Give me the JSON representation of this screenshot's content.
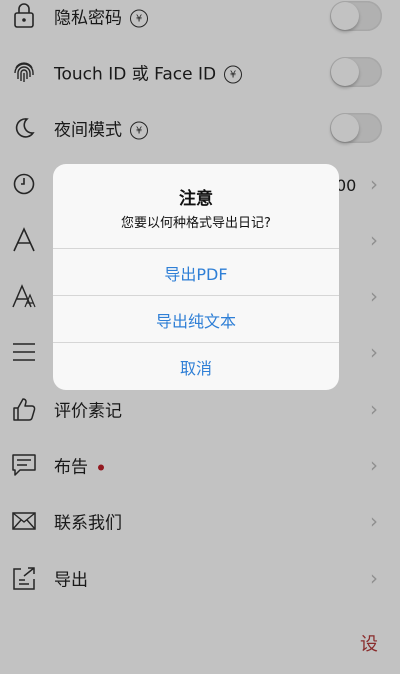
{
  "settings": {
    "items": [
      {
        "label": "隐私密码",
        "icon": "lock-icon",
        "premium": "¥",
        "control": "toggle"
      },
      {
        "label": "Touch ID 或 Face ID",
        "icon": "fingerprint-icon",
        "premium": "¥",
        "control": "toggle"
      },
      {
        "label": "夜间模式",
        "icon": "moon-icon",
        "premium": "¥",
        "control": "toggle"
      },
      {
        "label": "00",
        "icon": "clock-icon",
        "control": "chevron"
      },
      {
        "label": "",
        "icon": "font-icon",
        "control": "chevron"
      },
      {
        "label": "",
        "icon": "font-size-icon",
        "control": "chevron"
      },
      {
        "label": "",
        "icon": "menu-lines-icon",
        "control": "chevron"
      },
      {
        "label": "评价素记",
        "icon": "thumbs-up-icon",
        "control": "chevron"
      },
      {
        "label": "布告",
        "icon": "message-icon",
        "control": "chevron",
        "badge_color": "#c0202a"
      },
      {
        "label": "联系我们",
        "icon": "mail-icon",
        "control": "chevron"
      },
      {
        "label": "导出",
        "icon": "export-icon",
        "control": "chevron"
      }
    ],
    "chevron_glyph": "›",
    "bottom_char": "设"
  },
  "dialog": {
    "title": "注意",
    "message": "您要以何种格式导出日记?",
    "buttons": [
      "导出PDF",
      "导出纯文本",
      "取消"
    ],
    "button_color": "#2f7fd6"
  }
}
